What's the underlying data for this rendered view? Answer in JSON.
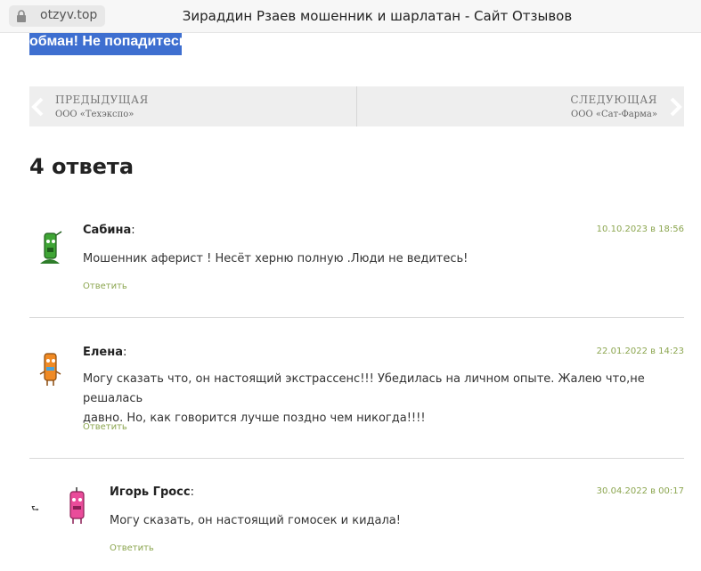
{
  "browser": {
    "url": "otzyv.top",
    "title": "Зираддин Рзаев мошенник и шарлатан - Сайт Отзывов"
  },
  "highlight_text": "обман! Не попадитесь!",
  "post_nav": {
    "prev_label": "ПРЕДЫДУЩАЯ",
    "prev_title": "ООО «Техэкспо»",
    "next_label": "СЛЕДУЮЩАЯ",
    "next_title": "ООО «Сат-Фарма»"
  },
  "comments_heading": "4 ответа",
  "comments": [
    {
      "author": "Сабина",
      "colon": ":",
      "date": "10.10.2023 в 18:56",
      "text": "Мошенник аферист ! Несёт херню полную .Люди не ведитесь!",
      "reply": "Ответить",
      "avatar_color": "#3fa535"
    },
    {
      "author": "Елена",
      "colon": ":",
      "date": "22.01.2022 в 14:23",
      "text_line1": "Могу сказать что, он настоящий экстрассенс!!! Убедилась на личном опыте. Жалею что,не решалась",
      "text_line2": "давно. Но, как говорится лучше поздно чем никогда!!!!",
      "reply": "Ответить",
      "avatar_color": "#f08a24"
    },
    {
      "author": "Игорь Гросс",
      "colon": ":",
      "date": "30.04.2022 в 00:17",
      "text": "Могу сказать, он настоящий гомосек и кидала!",
      "reply": "Ответить",
      "avatar_color": "#e94c9a",
      "thread_marker": "⮑"
    }
  ],
  "colors": {
    "accent_green": "#8ca650",
    "highlight_blue": "#3e6fd0",
    "nav_bg": "#eeeeee"
  },
  "icons": {
    "lock": "lock-icon",
    "prev_arrow": "chevron-left-icon",
    "next_arrow": "chevron-right-icon",
    "reply_marker": "reply-arrow-icon"
  }
}
